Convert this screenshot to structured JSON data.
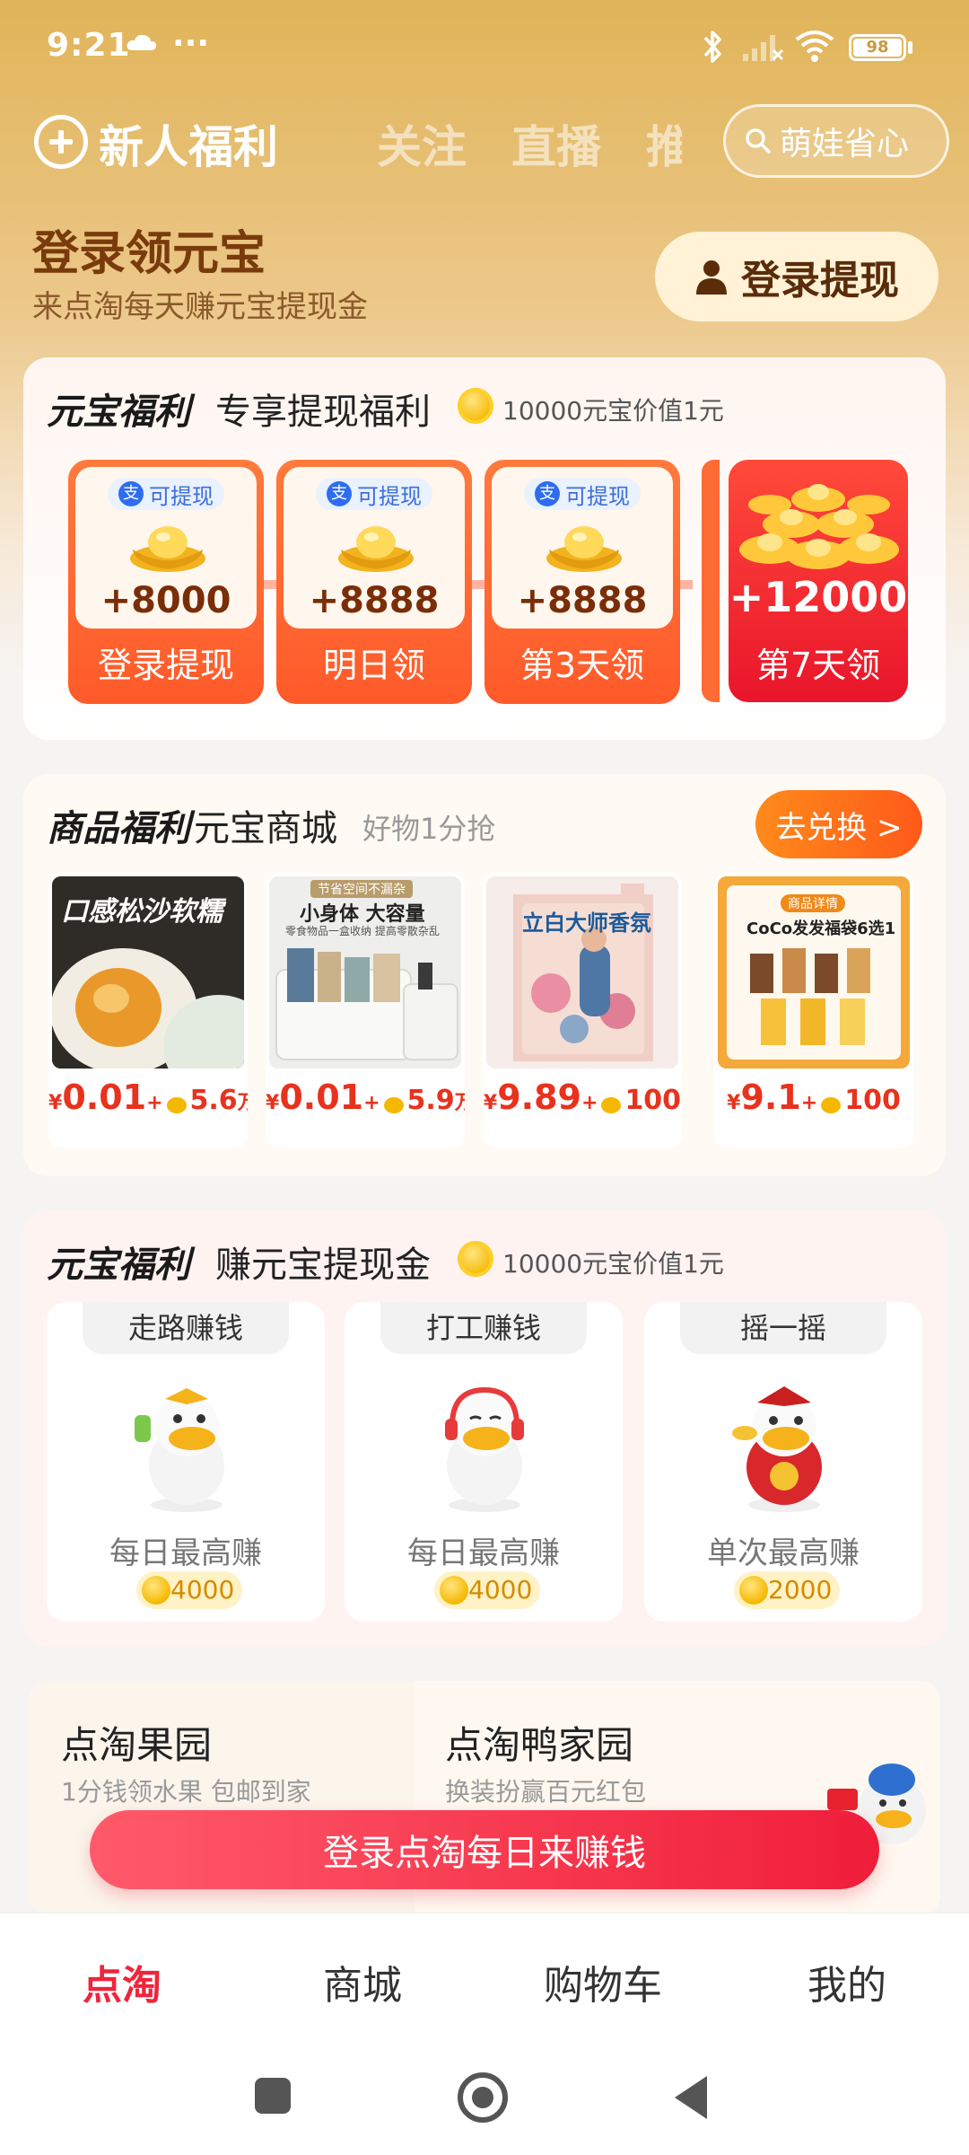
{
  "status_bar": {
    "time": "9:21",
    "dots": "···",
    "battery": "98"
  },
  "top_tabs": {
    "items": [
      "新人福利",
      "关注",
      "直播",
      "推"
    ],
    "search_text": "萌娃省心"
  },
  "login_header": {
    "title": "登录领元宝",
    "subtitle": "来点淘每天赚元宝提现金",
    "button": "登录提现"
  },
  "withdraw_card": {
    "title": "元宝福利",
    "subtitle": "专享提现福利",
    "note": "10000元宝价值1元",
    "tiles": [
      {
        "badge": "可提现",
        "amount": "+8000",
        "label": "登录提现"
      },
      {
        "badge": "可提现",
        "amount": "+8888",
        "label": "明日领"
      },
      {
        "badge": "可提现",
        "amount": "+8888",
        "label": "第3天领"
      }
    ],
    "big_tile": {
      "amount": "+12000",
      "label": "第7天领"
    }
  },
  "mall_card": {
    "title": "商品福利",
    "subtitle": "元宝商城",
    "note": "好物1分抢",
    "button": "去兑换 >",
    "products": [
      {
        "image_text": "口感松沙软糯",
        "price": "0.01",
        "coins": "5.6",
        "unit": "万"
      },
      {
        "image_text": "小身体 大容量",
        "image_sub": "零食物品一盒收纳 提高零散杂乱",
        "image_tag": "节省空间不漏杂",
        "price": "0.01",
        "coins": "5.9",
        "unit": "万"
      },
      {
        "image_text": "立白大师香氛",
        "price": "9.89",
        "coins": "100",
        "unit": ""
      },
      {
        "image_text": "CoCo发发福袋6选1",
        "image_tag": "商品详情",
        "price": "9.1",
        "coins": "100",
        "unit": ""
      }
    ]
  },
  "earn_card": {
    "title": "元宝福利",
    "subtitle": "赚元宝提现金",
    "note": "10000元宝价值1元",
    "tasks": [
      {
        "tab": "走路赚钱",
        "label": "每日最高赚",
        "coins": "4000"
      },
      {
        "tab": "打工赚钱",
        "label": "每日最高赚",
        "coins": "4000"
      },
      {
        "tab": "摇一摇",
        "label": "单次最高赚",
        "coins": "2000"
      }
    ]
  },
  "farm_section": {
    "left": {
      "title": "点淘果园",
      "subtitle": "1分钱领水果 包邮到家"
    },
    "right": {
      "title": "点淘鸭家园",
      "subtitle": "换装扮赢百元红包"
    }
  },
  "cta_button": "登录点淘每日来赚钱",
  "bottom_nav": [
    "点淘",
    "商城",
    "购物车",
    "我的"
  ],
  "colors": {
    "accent": "#f0243c",
    "gold": "#e0b458",
    "orange": "#ff5a2a"
  }
}
